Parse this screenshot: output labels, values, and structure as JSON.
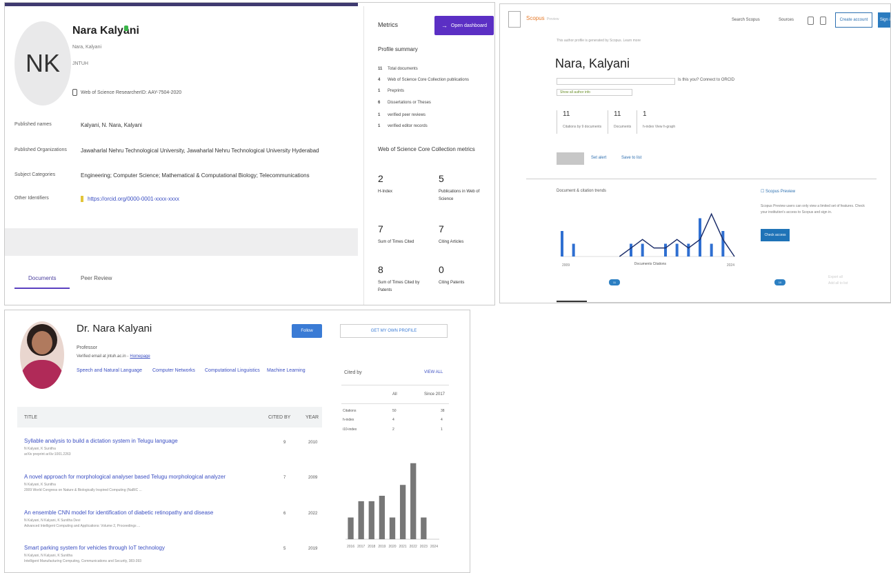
{
  "wos": {
    "initials": "NK",
    "name": "Nara Kalyani",
    "alt_name": "Nara, Kalyani",
    "institution": "JNTUH",
    "id_line": "Web of Science ResearcherID: AAY-7504-2020",
    "info": [
      {
        "label": "Published names",
        "value": "Kalyani, N.   Nara, Kalyani",
        "link": false
      },
      {
        "label": "Published Organizations",
        "value": "Jawaharlal Nehru Technological University, Jawaharlal Nehru Technological University Hyderabad",
        "link": false
      },
      {
        "label": "Subject Categories",
        "value": "Engineering; Computer Science; Mathematical & Computational Biology; Telecommunications",
        "link": false
      },
      {
        "label": "Other Identifiers",
        "value": "https://orcid.org/0000-0001-xxxx-xxxx",
        "link": true
      }
    ],
    "tabs": [
      "Documents",
      "Peer Review"
    ],
    "metrics": {
      "title": "Metrics",
      "open_dashboard": "Open dashboard",
      "profile_summary": "Profile summary",
      "summary_items": [
        {
          "num": "11",
          "label": "Total documents"
        },
        {
          "num": "4",
          "label": "Web of Science Core Collection publications"
        },
        {
          "num": "1",
          "label": "Preprints"
        },
        {
          "num": "6",
          "label": "Dissertations or Theses"
        },
        {
          "num": "1",
          "label": "verified peer reviews"
        },
        {
          "num": "1",
          "label": "verified editor records"
        }
      ],
      "collection_title": "Web of Science Core Collection metrics",
      "values": [
        {
          "value": "2",
          "label": "H-Index"
        },
        {
          "value": "5",
          "label": "Publications in Web of Science"
        },
        {
          "value": "7",
          "label": "Sum of Times Cited"
        },
        {
          "value": "7",
          "label": "Citing Articles"
        },
        {
          "value": "8",
          "label": "Sum of Times Cited by Patents"
        },
        {
          "value": "0",
          "label": "Citing Patents"
        }
      ]
    }
  },
  "orcid": {
    "brand": "Scopus",
    "brand_preview": "Preview",
    "nav": [
      "Search Scopus",
      "Sources"
    ],
    "create_account": "Create account",
    "sign_in": "Sign in",
    "breadcrumb": "This author profile is generated by Scopus. Learn more",
    "name": "Nara, Kalyani",
    "id_text": "Connect to ORCID",
    "id_text2": "Is this you?",
    "verified": "Show all author info",
    "stats": [
      {
        "value": "11",
        "label": "Citations by 9 documents"
      },
      {
        "value": "11",
        "label": "Documents"
      },
      {
        "value": "1",
        "label": "h-index View h-graph"
      }
    ],
    "links": [
      "Set alert",
      "Save to list"
    ],
    "chart_title": "Document & citation trends",
    "side_check": "Scopus Preview",
    "side_text": "Scopus Preview users can only view a limited set of features. Check your institution's access to Scopus and sign in.",
    "side_button": "Check access",
    "badges": [
      "11",
      "10"
    ],
    "faded": [
      "Export all",
      "Add all to list"
    ],
    "chart_legend": "Documents   Citations"
  },
  "gs": {
    "name": "Dr. Nara Kalyani",
    "role": "Professor",
    "email": "Verified email at jntuh.ac.in -",
    "email_link": "Homepage",
    "interests": [
      "Speech and Natural Language",
      "Computer Networks",
      "Computational Linguistics",
      "Machine Learning"
    ],
    "follow": "Follow",
    "get_profile": "GET MY OWN PROFILE",
    "table_header": {
      "title": "TITLE",
      "cited": "CITED BY",
      "year": "YEAR"
    },
    "articles": [
      {
        "title": "Syllable analysis to build a dictation system in Telugu language",
        "authors": "N Kalyani, K Sunitha",
        "venue": "arXiv preprint arXiv:1001.2263",
        "cited": "9",
        "year": "2010"
      },
      {
        "title": "A novel approach for morphological analyser based Telugu morphological analyzer",
        "authors": "N Kalyani, K Sunitha",
        "venue": "2009 World Congress on Nature & Biologically Inspired Computing (NaBIC ...",
        "cited": "7",
        "year": "2009"
      },
      {
        "title": "An ensemble CNN model for identification of diabetic retinopathy and disease",
        "authors": "N Kalyani, N Kalyani, K Sunitha Devi",
        "venue": "Advanced Intelligent Computing and Applications: Volume 2, Proceedings ...",
        "cited": "6",
        "year": "2022"
      },
      {
        "title": "Smart parking system for vehicles through IoT technology",
        "authors": "N Kalyani, N Kalyani, K Sunitha",
        "venue": "Intelligent Manufacturing Computing, Communications and Security, 383-393",
        "cited": "5",
        "year": "2019"
      }
    ],
    "cited_by": {
      "title": "Cited by",
      "view_all": "VIEW ALL",
      "col_all": "All",
      "col_since": "Since 2017",
      "rows": [
        {
          "label": "Citations",
          "all": "50",
          "since": "38"
        },
        {
          "label": "h-index",
          "all": "4",
          "since": "4"
        },
        {
          "label": "i10-index",
          "all": "2",
          "since": "1"
        }
      ]
    }
  },
  "chart_data": [
    {
      "type": "bar",
      "title": "",
      "categories": [
        "2016",
        "2017",
        "2018",
        "2019",
        "2020",
        "2021",
        "2022",
        "2023",
        "2024"
      ],
      "values": [
        4,
        7,
        7,
        8,
        4,
        10,
        14,
        4,
        0
      ],
      "ylim": [
        0,
        16
      ]
    },
    {
      "type": "line",
      "title": "Document & citation trends",
      "x": [
        "2009",
        "2010",
        "2011",
        "2012",
        "2013",
        "2014",
        "2015",
        "2016",
        "2017",
        "2018",
        "2019",
        "2020",
        "2021",
        "2022",
        "2023",
        "2024"
      ],
      "series": [
        {
          "name": "Documents",
          "values": [
            2,
            1,
            0,
            0,
            0,
            0,
            1,
            1,
            0,
            1,
            1,
            1,
            3,
            1,
            2,
            0
          ]
        },
        {
          "name": "Citations",
          "values": [
            0,
            0,
            0,
            0,
            0,
            0,
            1,
            2,
            1,
            1,
            2,
            1,
            2,
            5,
            2,
            0
          ]
        }
      ]
    }
  ]
}
